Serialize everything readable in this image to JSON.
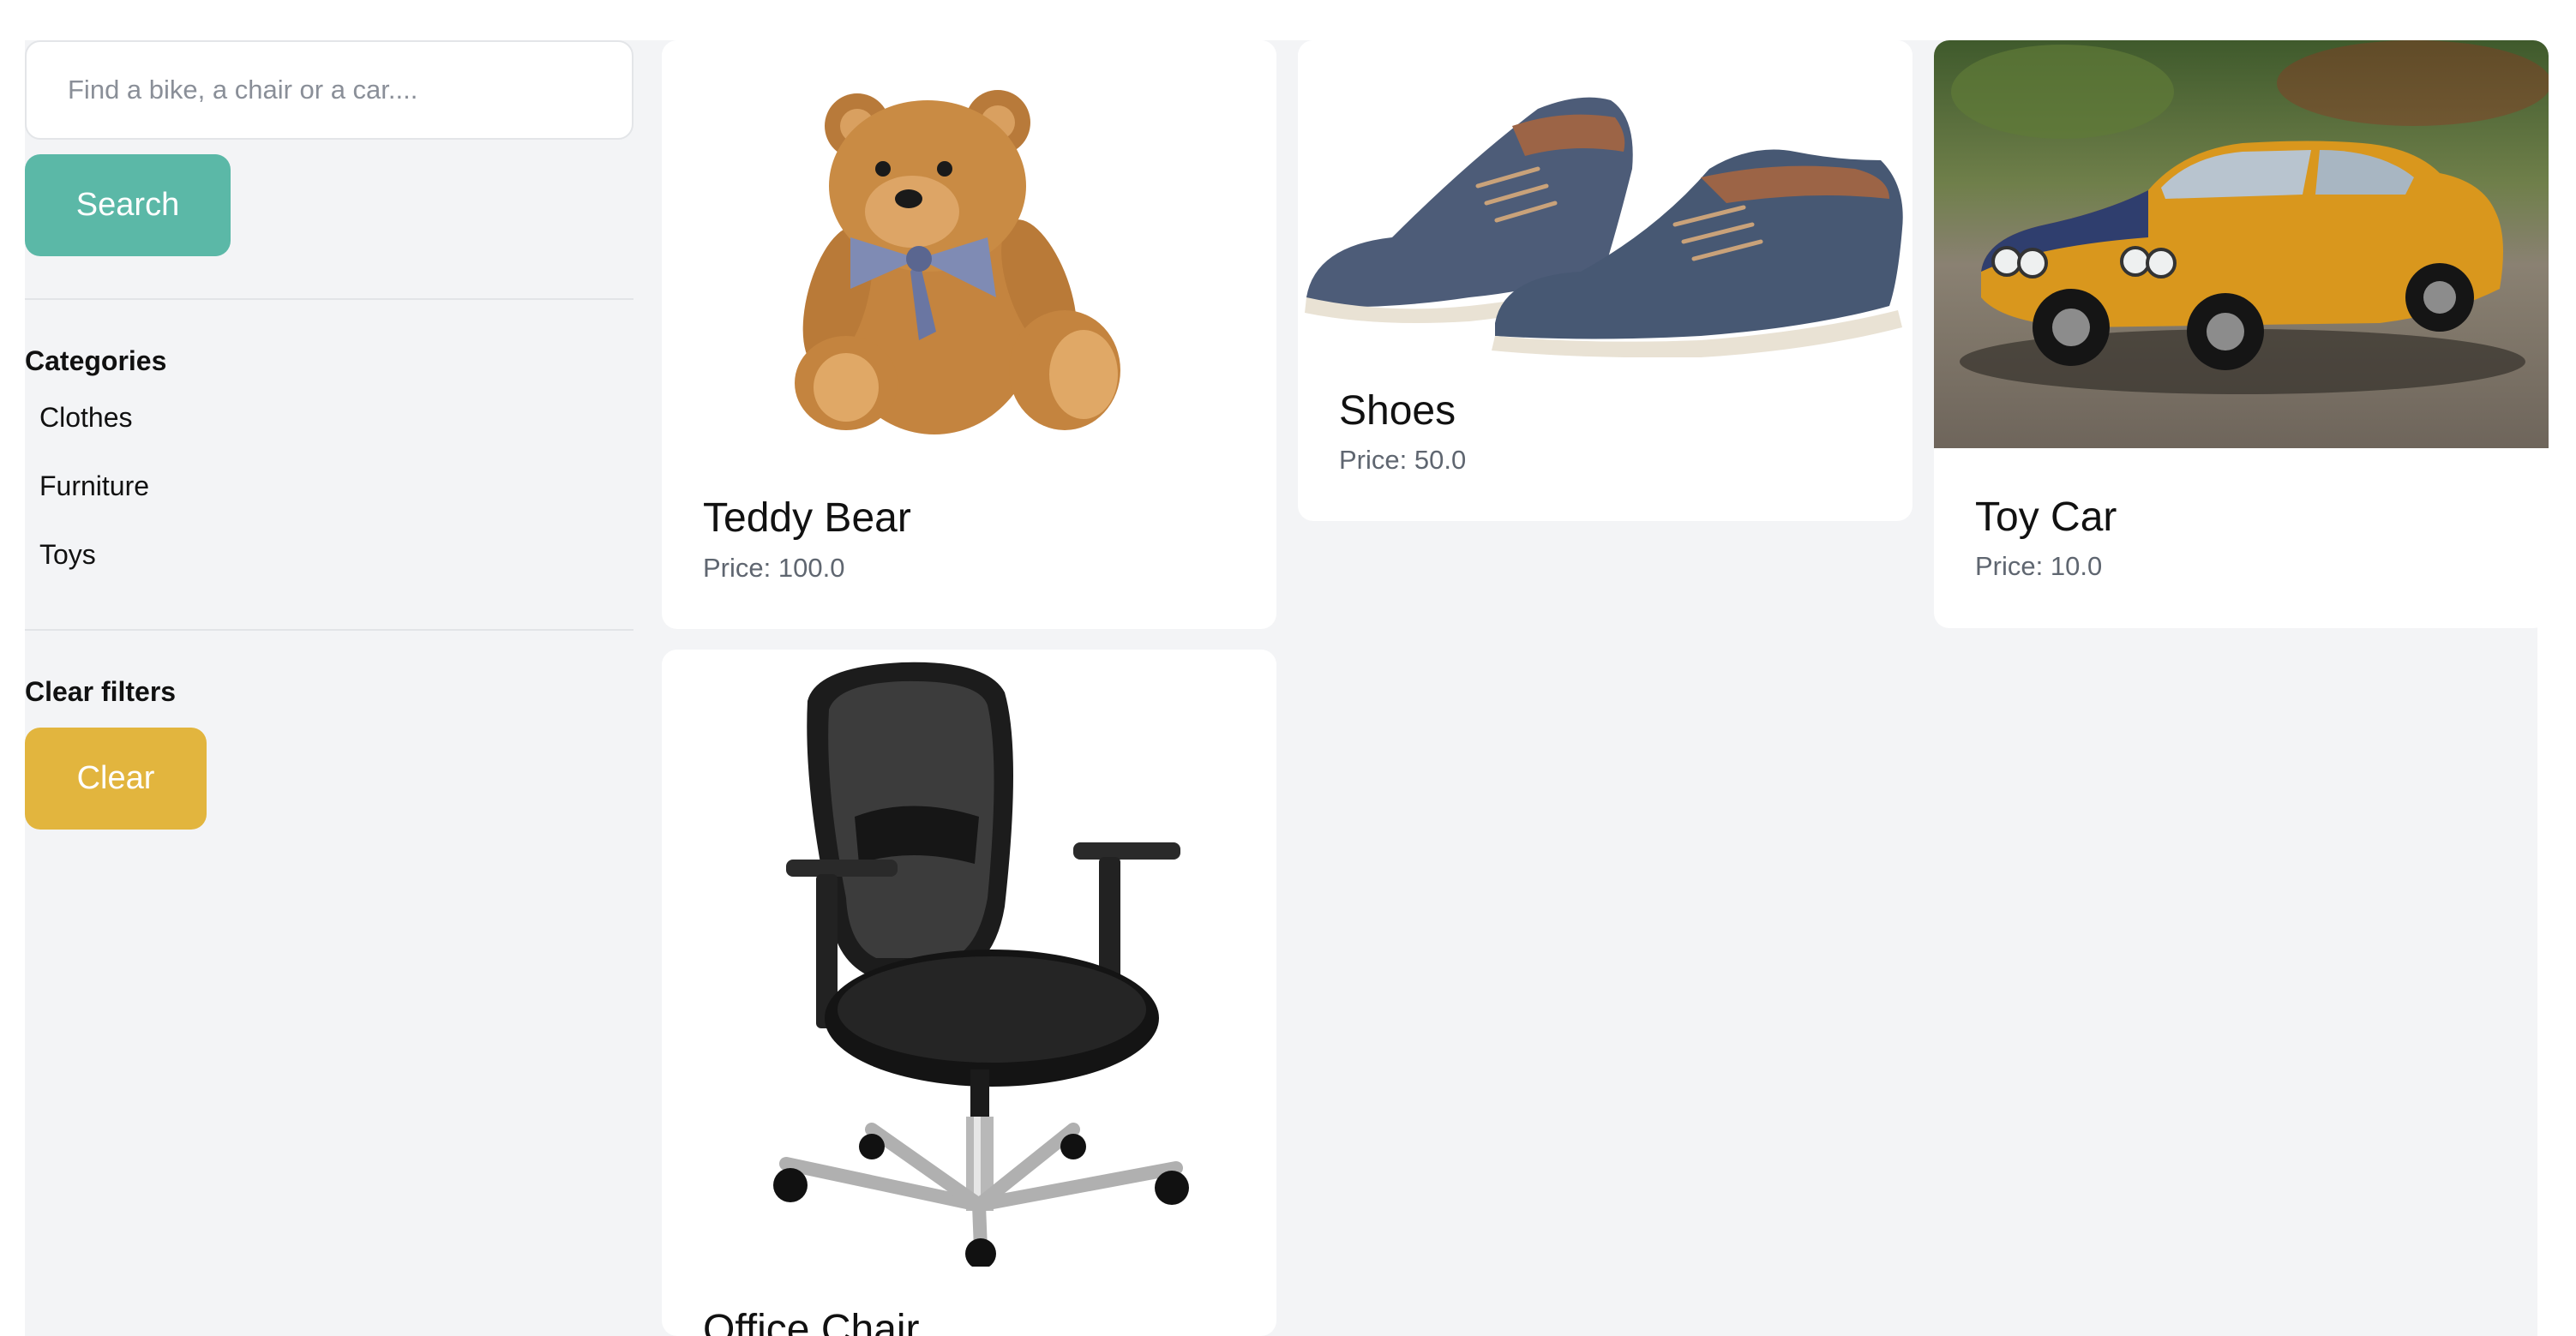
{
  "search": {
    "placeholder": "Find a bike, a chair or a car....",
    "button_label": "Search",
    "button_color": "#5bb8a7"
  },
  "categories": {
    "title": "Categories",
    "items": [
      "Clothes",
      "Furniture",
      "Toys"
    ]
  },
  "clear": {
    "title": "Clear filters",
    "button_label": "Clear",
    "button_color": "#e2b53e"
  },
  "products": [
    {
      "name": "Teddy Bear",
      "price": "Price: 100.0",
      "image": "teddy-bear-photo"
    },
    {
      "name": "Shoes",
      "price": "Price: 50.0",
      "image": "shoes-photo"
    },
    {
      "name": "Toy Car",
      "price": "Price: 10.0",
      "image": "toy-car-photo"
    },
    {
      "name": "Office Chair",
      "price": "",
      "image": "office-chair-photo"
    }
  ]
}
